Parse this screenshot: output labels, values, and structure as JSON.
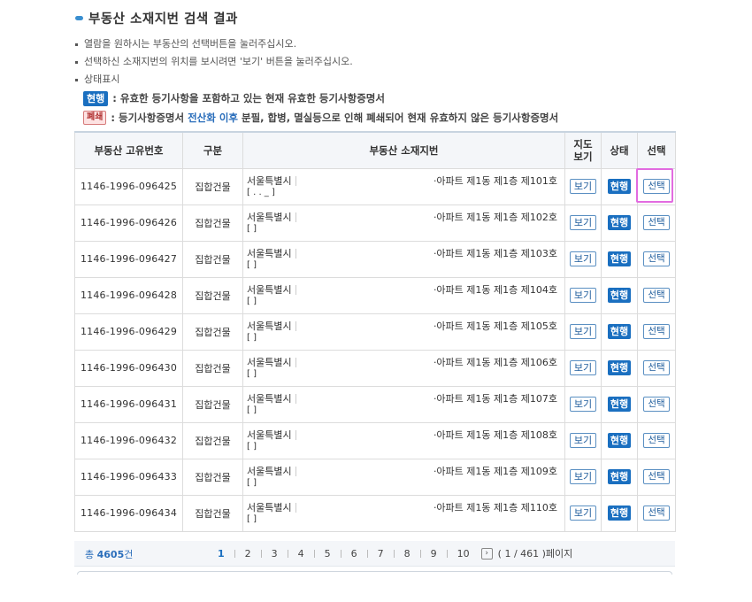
{
  "page_title": "부동산 소재지번 검색 결과",
  "notes": [
    "열람을 원하시는 부동산의 선택버튼을 눌러주십시오.",
    "선택하신 소재지번의 위치를 보시려면 '보기' 버튼을 눌러주십시오.",
    "상태표시"
  ],
  "legend": {
    "current_badge": "현행",
    "current_desc": "유효한 등기사항을 포함하고 있는 현재 유효한 등기사항증명서",
    "closed_badge": "폐쇄",
    "closed_desc_1": "등기사항증명서",
    "closed_desc_hl": "전산화 이후",
    "closed_desc_2": "분필, 합병, 멸실등으로 인해 폐쇄되어 현재 유효하지 않은 등기사항증명서",
    "separator": ":"
  },
  "table": {
    "headers": {
      "number": "부동산 고유번호",
      "type": "구분",
      "address": "부동산 소재지번",
      "map": "지도보기",
      "status": "상태",
      "select": "선택"
    },
    "rows": [
      {
        "number": "1146-1996-096425",
        "type": "집합건물",
        "city": "서울특별시",
        "detail": "·아파트 제1동 제1층 제101호",
        "line2": "[ . . _ ]",
        "map_btn": "보기",
        "status": "현행",
        "select_btn": "선택"
      },
      {
        "number": "1146-1996-096426",
        "type": "집합건물",
        "city": "서울특별시",
        "detail": "·아파트 제1동 제1층 제102호",
        "line2": "[ ]",
        "map_btn": "보기",
        "status": "현행",
        "select_btn": "선택"
      },
      {
        "number": "1146-1996-096427",
        "type": "집합건물",
        "city": "서울특별시",
        "detail": "·아파트 제1동 제1층 제103호",
        "line2": "[ ]",
        "map_btn": "보기",
        "status": "현행",
        "select_btn": "선택"
      },
      {
        "number": "1146-1996-096428",
        "type": "집합건물",
        "city": "서울특별시",
        "detail": "·아파트 제1동 제1층 제104호",
        "line2": "[ ]",
        "map_btn": "보기",
        "status": "현행",
        "select_btn": "선택"
      },
      {
        "number": "1146-1996-096429",
        "type": "집합건물",
        "city": "서울특별시",
        "detail": "·아파트 제1동 제1층 제105호",
        "line2": "[ ]",
        "map_btn": "보기",
        "status": "현행",
        "select_btn": "선택"
      },
      {
        "number": "1146-1996-096430",
        "type": "집합건물",
        "city": "서울특별시",
        "detail": "·아파트 제1동 제1층 제106호",
        "line2": "[ ]",
        "map_btn": "보기",
        "status": "현행",
        "select_btn": "선택"
      },
      {
        "number": "1146-1996-096431",
        "type": "집합건물",
        "city": "서울특별시",
        "detail": "·아파트 제1동 제1층 제107호",
        "line2": "[ ]",
        "map_btn": "보기",
        "status": "현행",
        "select_btn": "선택"
      },
      {
        "number": "1146-1996-096432",
        "type": "집합건물",
        "city": "서울특별시",
        "detail": "·아파트 제1동 제1층 제108호",
        "line2": "[ ]",
        "map_btn": "보기",
        "status": "현행",
        "select_btn": "선택"
      },
      {
        "number": "1146-1996-096433",
        "type": "집합건물",
        "city": "서울특별시",
        "detail": "·아파트 제1동 제1층 제109호",
        "line2": "[ ]",
        "map_btn": "보기",
        "status": "현행",
        "select_btn": "선택"
      },
      {
        "number": "1146-1996-096434",
        "type": "집합건물",
        "city": "서울특별시",
        "detail": "·아파트 제1동 제1층 제110호",
        "line2": "[ ]",
        "map_btn": "보기",
        "status": "현행",
        "select_btn": "선택"
      }
    ]
  },
  "footer": {
    "total_prefix": "총",
    "total_count": "4605",
    "total_suffix": "건",
    "pages": [
      "1",
      "2",
      "3",
      "4",
      "5",
      "6",
      "7",
      "8",
      "9",
      "10"
    ],
    "current_page": "1",
    "next_icon": "chevron-right-icon",
    "page_info": "( 1 / 461 )페이지"
  },
  "colors": {
    "accent": "#1a6fc0",
    "highlight": "#e26be0",
    "closed": "#b03030"
  }
}
